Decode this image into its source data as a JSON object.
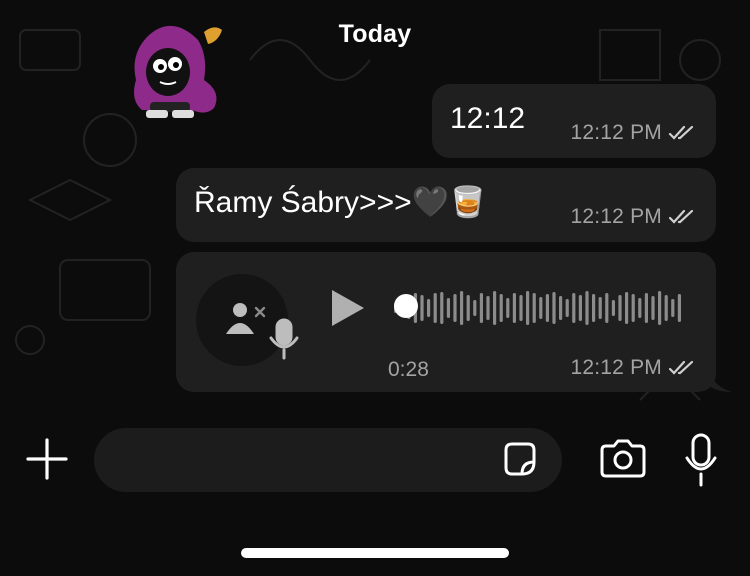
{
  "chat": {
    "date_separator": "Today",
    "messages": [
      {
        "text": "12:12",
        "time": "12:12 PM",
        "status": "read"
      },
      {
        "text": "Řamy Śabry>>>🖤🥃",
        "time": "12:12 PM",
        "status": "read"
      }
    ],
    "voice_message": {
      "duration": "0:28",
      "time": "12:12 PM",
      "status": "read"
    }
  },
  "composer": {
    "placeholder": "",
    "value": ""
  },
  "icons": {
    "plus": "plus-icon",
    "sticker": "sticker-icon",
    "camera": "camera-icon",
    "mic": "mic-icon",
    "play": "play-icon",
    "read_receipt": "double-check-icon"
  },
  "colors": {
    "background": "#0c0c0c",
    "bubble": "#1f1f1f",
    "timestamp": "#a3a3a3",
    "read_ticks": "#d0d0d0"
  }
}
